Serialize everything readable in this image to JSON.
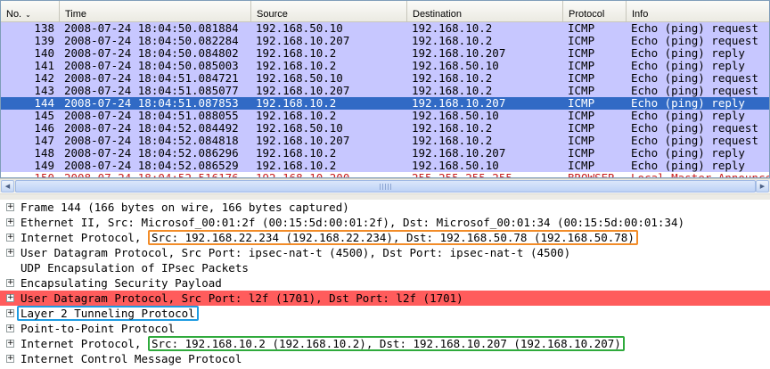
{
  "columns": [
    {
      "name": "No.",
      "sort_indicator": "⌄"
    },
    {
      "name": "Time"
    },
    {
      "name": "Source"
    },
    {
      "name": "Destination"
    },
    {
      "name": "Protocol"
    },
    {
      "name": "Info"
    }
  ],
  "packets": [
    {
      "no": "138",
      "time": "2008-07-24 18:04:50.081884",
      "src": "192.168.50.10",
      "dst": "192.168.10.2",
      "proto": "ICMP",
      "info": "Echo (ping) request"
    },
    {
      "no": "139",
      "time": "2008-07-24 18:04:50.082284",
      "src": "192.168.10.207",
      "dst": "192.168.10.2",
      "proto": "ICMP",
      "info": "Echo (ping) request"
    },
    {
      "no": "140",
      "time": "2008-07-24 18:04:50.084802",
      "src": "192.168.10.2",
      "dst": "192.168.10.207",
      "proto": "ICMP",
      "info": "Echo (ping) reply"
    },
    {
      "no": "141",
      "time": "2008-07-24 18:04:50.085003",
      "src": "192.168.10.2",
      "dst": "192.168.50.10",
      "proto": "ICMP",
      "info": "Echo (ping) reply"
    },
    {
      "no": "142",
      "time": "2008-07-24 18:04:51.084721",
      "src": "192.168.50.10",
      "dst": "192.168.10.2",
      "proto": "ICMP",
      "info": "Echo (ping) request"
    },
    {
      "no": "143",
      "time": "2008-07-24 18:04:51.085077",
      "src": "192.168.10.207",
      "dst": "192.168.10.2",
      "proto": "ICMP",
      "info": "Echo (ping) request"
    },
    {
      "no": "144",
      "time": "2008-07-24 18:04:51.087853",
      "src": "192.168.10.2",
      "dst": "192.168.10.207",
      "proto": "ICMP",
      "info": "Echo (ping) reply",
      "selected": true
    },
    {
      "no": "145",
      "time": "2008-07-24 18:04:51.088055",
      "src": "192.168.10.2",
      "dst": "192.168.50.10",
      "proto": "ICMP",
      "info": "Echo (ping) reply"
    },
    {
      "no": "146",
      "time": "2008-07-24 18:04:52.084492",
      "src": "192.168.50.10",
      "dst": "192.168.10.2",
      "proto": "ICMP",
      "info": "Echo (ping) request"
    },
    {
      "no": "147",
      "time": "2008-07-24 18:04:52.084818",
      "src": "192.168.10.207",
      "dst": "192.168.10.2",
      "proto": "ICMP",
      "info": "Echo (ping) request"
    },
    {
      "no": "148",
      "time": "2008-07-24 18:04:52.086296",
      "src": "192.168.10.2",
      "dst": "192.168.10.207",
      "proto": "ICMP",
      "info": "Echo (ping) reply"
    },
    {
      "no": "149",
      "time": "2008-07-24 18:04:52.086529",
      "src": "192.168.10.2",
      "dst": "192.168.50.10",
      "proto": "ICMP",
      "info": "Echo (ping) reply"
    },
    {
      "no": "150",
      "time": "2008-07-24 18:04:52.516176",
      "src": "192.168.10.200",
      "dst": "255.255.255.255",
      "proto": "BROWSER",
      "info": "Local Master Announcement",
      "partial": true
    }
  ],
  "scrollbar": {
    "left_arrow": "◀",
    "right_arrow": "▶"
  },
  "details": [
    {
      "expander": "+",
      "text": "Frame 144 (166 bytes on wire, 166 bytes captured)"
    },
    {
      "expander": "+",
      "text": "Ethernet II, Src: Microsof_00:01:2f (00:15:5d:00:01:2f), Dst: Microsof_00:01:34 (00:15:5d:00:01:34)"
    },
    {
      "expander": "+",
      "prefix": "Internet Protocol, ",
      "highlight": "Src: 192.168.22.234 (192.168.22.234), Dst: 192.168.50.78 (192.168.50.78)",
      "box_color": "orange"
    },
    {
      "expander": "+",
      "text": "User Datagram Protocol, Src Port: ipsec-nat-t (4500), Dst Port: ipsec-nat-t (4500)"
    },
    {
      "expander": "",
      "text": "UDP Encapsulation of IPsec Packets"
    },
    {
      "expander": "+",
      "text": "Encapsulating Security Payload"
    },
    {
      "expander": "+",
      "text": "User Datagram Protocol, Src Port: l2f (1701), Dst Port: l2f (1701)",
      "row_color": "red"
    },
    {
      "expander": "+",
      "prefix": "",
      "highlight": "Layer 2 Tunneling Protocol",
      "box_color": "blue"
    },
    {
      "expander": "+",
      "text": "Point-to-Point Protocol"
    },
    {
      "expander": "+",
      "prefix": "Internet Protocol, ",
      "highlight": "Src: 192.168.10.2 (192.168.10.2), Dst: 192.168.10.207 (192.168.10.207)",
      "box_color": "green"
    },
    {
      "expander": "+",
      "text": "Internet Control Message Protocol"
    }
  ]
}
